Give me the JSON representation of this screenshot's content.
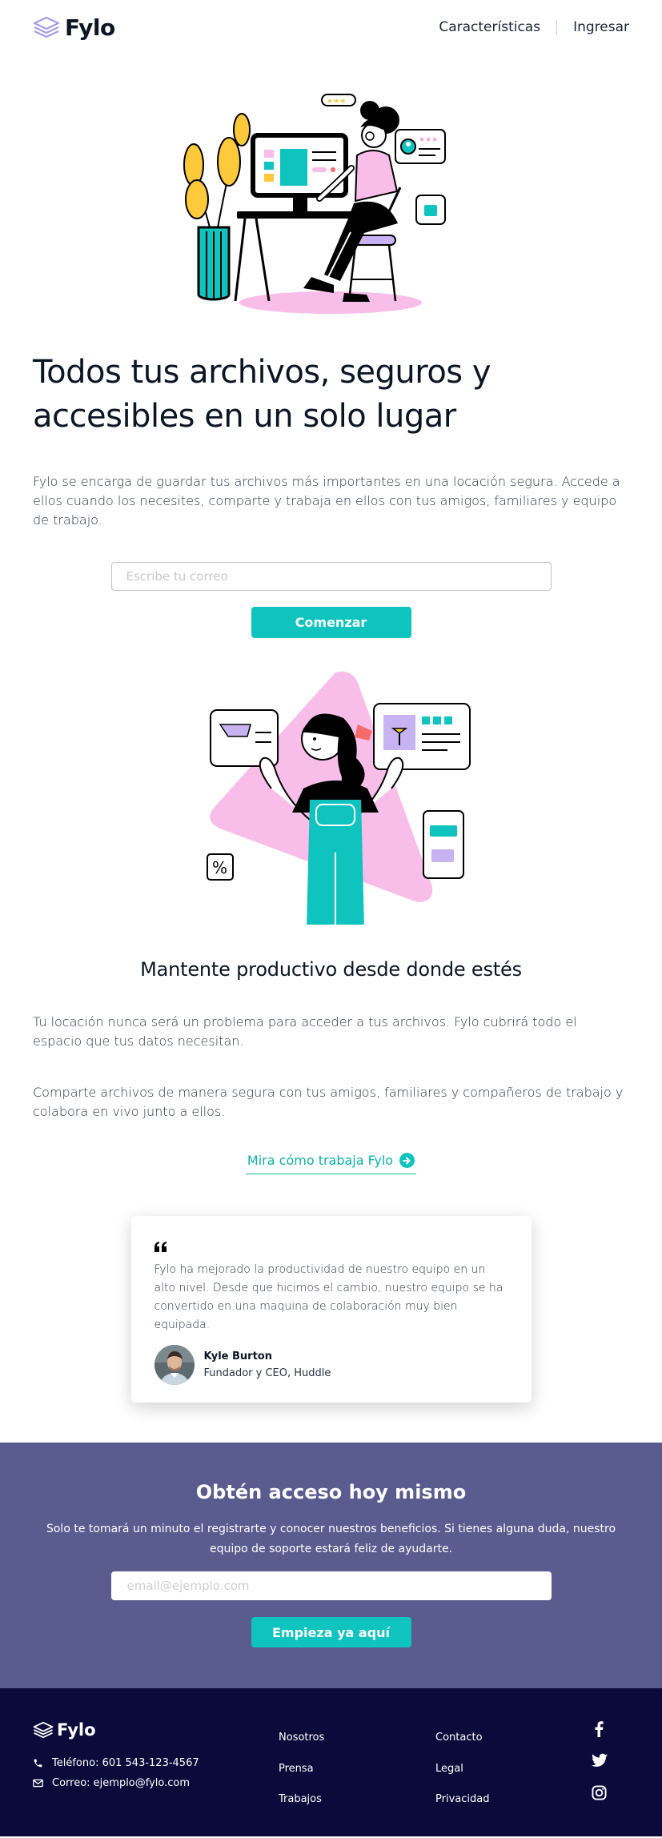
{
  "header": {
    "logo": "Fylo",
    "nav": [
      {
        "label": "Características"
      },
      {
        "label": "Ingresar"
      }
    ]
  },
  "hero": {
    "title": "Todos tus archivos, seguros y accesibles en un solo lugar",
    "description": "Fylo se encarga de guardar tus archivos más importantes en una locación segura. Accede a ellos cuando los necesites, comparte y trabaja en ellos con tus amigos, familiares y equipo de trabajo.",
    "email_placeholder": "Escribe tu correo",
    "cta": "Comenzar"
  },
  "productive": {
    "title": "Mantente productivo desde donde estés",
    "paragraph1": "Tu locación nunca será un problema para acceder a tus archivos. Fylo cubrirá todo el espacio que tus datos necesitan.",
    "paragraph2": "Comparte archivos de manera segura con tus amigos, familiares y compañeros de trabajo y colabora en vivo junto a ellos.",
    "link": "Mira cómo trabaja Fylo"
  },
  "testimonial": {
    "quote": "Fylo ha mejorado la productividad de nuestro equipo en un alto nivel. Desde que hicimos el cambio, nuestro equipo se ha convertido en una maquina de colaboración muy bien equipada.",
    "name": "Kyle Burton",
    "role": "Fundador y CEO, Huddle"
  },
  "access": {
    "title": "Obtén acceso hoy mismo",
    "description": "Solo te tomará un minuto el registrarte y conocer nuestros beneficios. Si tienes alguna duda, nuestro equipo de soporte estará feliz de ayudarte.",
    "email_placeholder": "email@ejemplo.com",
    "cta": "Empieza ya aquí"
  },
  "footer": {
    "logo": "Fylo",
    "phone": "Teléfono: 601 543-123-4567",
    "email": "Correo: ejemplo@fylo.com",
    "col1": [
      "Nosotros",
      "Prensa",
      "Trabajos"
    ],
    "col2": [
      "Contacto",
      "Legal",
      "Privacidad"
    ],
    "social": [
      "facebook-icon",
      "twitter-icon",
      "instagram-icon"
    ]
  },
  "colors": {
    "accent": "#0fc3be",
    "access_bg": "#5a5b8e",
    "footer_bg": "#0c0a3a",
    "text": "#0c1524"
  }
}
